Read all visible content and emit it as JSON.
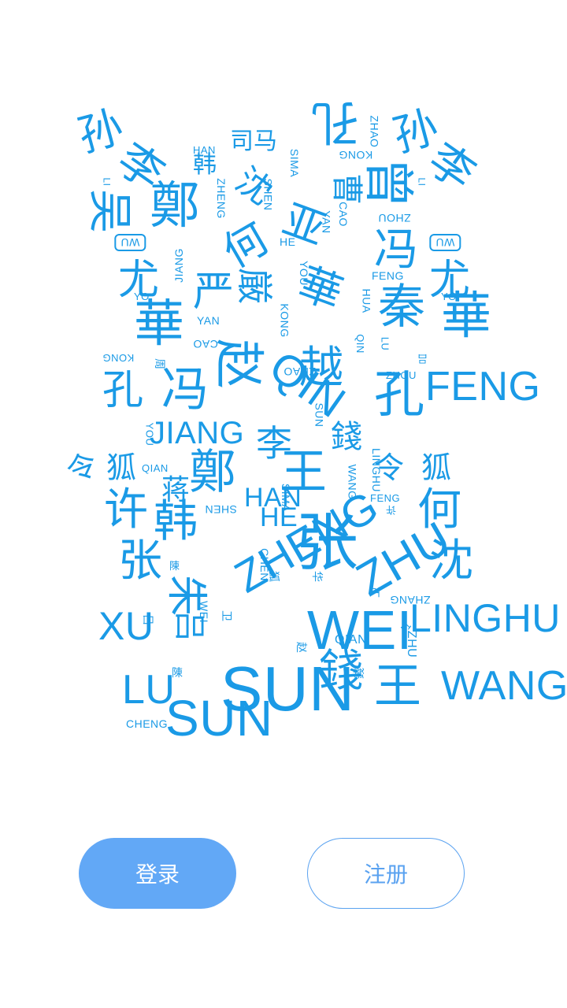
{
  "colors": {
    "accent": "#1a9ae6",
    "login_bg": "#62a8f6",
    "register_text": "#5aa2f0",
    "background": "#ffffff"
  },
  "word_cloud": {
    "words": [
      "孙",
      "李",
      "孔",
      "孙",
      "李",
      "韩",
      "司马",
      "HAN",
      "SIMA",
      "ZHAO",
      "KONG",
      "LI",
      "LI",
      "吴",
      "鄭",
      "沈",
      "何",
      "亚",
      "曹",
      "曾",
      "WU",
      "WU",
      "ZHENG",
      "SHEN",
      "HE",
      "YAN",
      "CAO",
      "ZHOU",
      "冯",
      "尤",
      "尤",
      "JIANG",
      "FENG",
      "YO",
      "YO",
      "YOU",
      "華",
      "严",
      "厳",
      "華",
      "華",
      "秦",
      "YAN",
      "CAO",
      "HUA",
      "KONG",
      "KONG",
      "吕",
      "孔",
      "孔",
      "FENG",
      "周",
      "赵",
      "越",
      "QIN",
      "QIN",
      "LU",
      "ZHOU",
      "ZHAO",
      "冯",
      "YOU",
      "JIANG",
      "SUN",
      "錢",
      "李",
      "令",
      "狐",
      "令",
      "狐",
      "蒋",
      "鄭",
      "王",
      "WANG",
      "QIAN",
      "LINGHU",
      "FENG",
      "许",
      "许",
      "何",
      "韩",
      "HAN",
      "SIMA",
      "HE",
      "陳",
      "张",
      "张",
      "沈",
      "ZHENG",
      "SHEN",
      "CHEN",
      "狐",
      "华",
      "朱",
      "ZHU",
      "卫",
      "卫",
      "ZHANG",
      "令",
      "XU",
      "LINGHU",
      "呂",
      "吕",
      "WEI",
      "WEI",
      "錢",
      "QIAN",
      "ZHU",
      "LU",
      "陳",
      "赵",
      "錢",
      "SUN",
      "王",
      "WANG",
      "CHENG",
      "SUN"
    ]
  },
  "actions": {
    "login_label": "登录",
    "register_label": "注册"
  }
}
